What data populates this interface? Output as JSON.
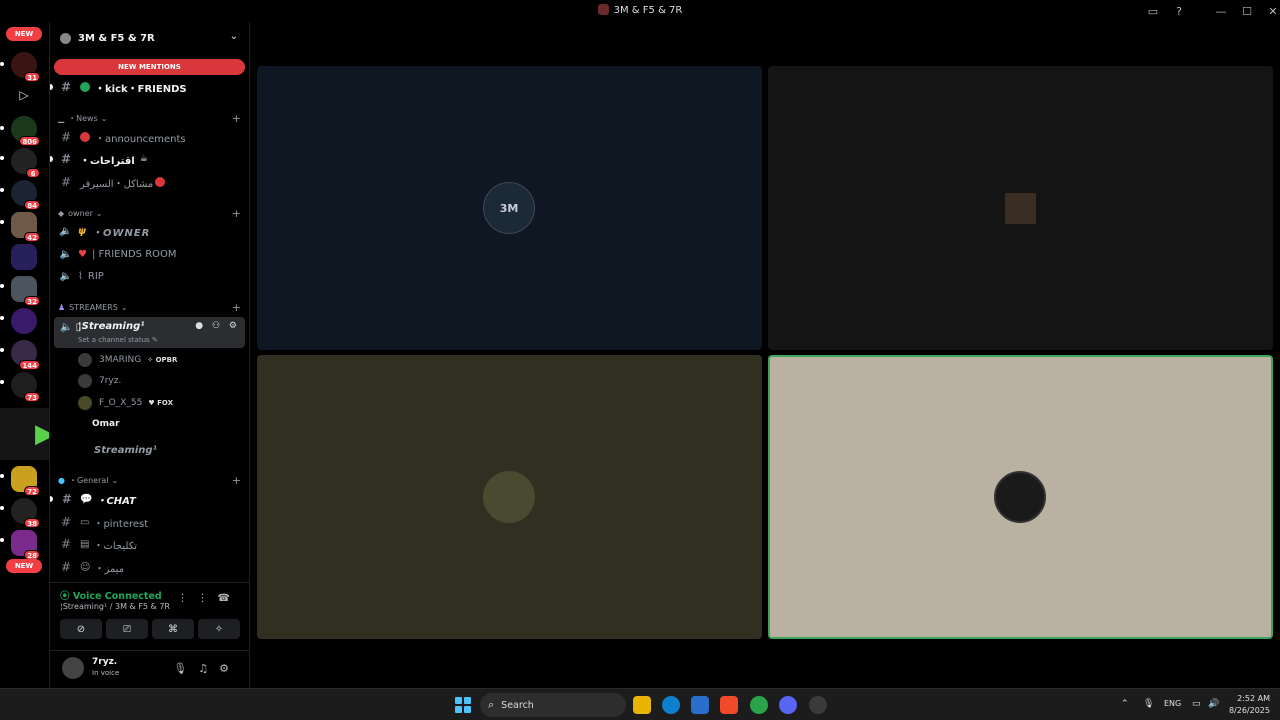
{
  "window": {
    "title": "3M & F5 & 7R"
  },
  "server": {
    "name": "3M & F5 & 7R",
    "new_mentions_label": "NEW MENTIONS"
  },
  "rail": {
    "new_label": "NEW",
    "badges": [
      "31",
      "806",
      "6",
      "84",
      "42",
      "32",
      "144",
      "73",
      "72",
      "38",
      "28"
    ]
  },
  "channels": {
    "top": [
      {
        "label": "・kick・FRIENDS"
      }
    ],
    "categories": {
      "news": "・News",
      "owner": "owner",
      "streamers": "STREAMERS",
      "general": "・General"
    },
    "news": [
      {
        "label": "・announcements"
      },
      {
        "label": "・اقتراحات"
      },
      {
        "label": "مشاكل・السيرفر"
      }
    ],
    "owner": [
      {
        "label": "・OWNER"
      },
      {
        "label": "| FRIENDS ROOM"
      },
      {
        "label": "RIP"
      }
    ],
    "streaming": {
      "name": "¦Streaming¹",
      "status": "Set a channel status",
      "members": [
        {
          "name": "3MARING",
          "tag": "OPBR"
        },
        {
          "name": "7ryz.",
          "tag": ""
        },
        {
          "name": "F_O_X_55",
          "tag": "FOX"
        },
        {
          "name": "Omar",
          "tag": ""
        }
      ],
      "second": "Streaming¹"
    },
    "general": [
      {
        "label": "・CHAT"
      },
      {
        "label": "・pinterest"
      },
      {
        "label": "・تكليجات"
      },
      {
        "label": "・ميمز"
      }
    ]
  },
  "voice": {
    "status": "Voice Connected",
    "location": "¦Streaming¹ / 3M & F5 & 7R"
  },
  "user": {
    "name": "7ryz.",
    "status": "In voice"
  },
  "tiles": [
    {
      "bg": "#0f1722",
      "avatar_text": "3M"
    },
    {
      "bg": "#141414",
      "avatar_text": ""
    },
    {
      "bg": "#312f21",
      "avatar_text": ""
    },
    {
      "bg": "#bab1a3",
      "avatar_text": ""
    }
  ],
  "taskbar": {
    "search_label": "Search",
    "lang": "ENG",
    "time": "2:52 AM",
    "date": "8/26/2025"
  },
  "colors": {
    "accent_green": "#23a55a",
    "mention_red": "#da373c",
    "speaking_outline": "#3ba55c"
  }
}
